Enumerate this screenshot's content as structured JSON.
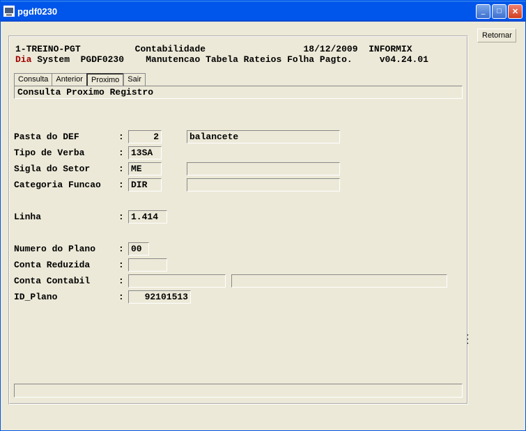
{
  "window": {
    "title": "pgdf0230"
  },
  "sidebar": {
    "retornar": "Retornar"
  },
  "header": {
    "line1_left": "1-TREINO-PGT",
    "line1_center": "Contabilidade",
    "line1_date": "18/12/2009",
    "line1_db": "INFORMIX",
    "line2_dia": "Dia",
    "line2_system": " System  PGDF0230",
    "line2_desc": "Manutencao Tabela Rateios Folha Pagto.",
    "line2_ver": "v04.24.01"
  },
  "tabs": {
    "consulta": "Consulta",
    "anterior": "Anterior",
    "proximo": "Proximo",
    "sair": "Sair"
  },
  "subbar": "Consulta Proximo Registro",
  "fields": {
    "pasta_def_label": "Pasta do DEF",
    "pasta_def_value": "2",
    "pasta_def_desc": "balancete",
    "tipo_verba_label": "Tipo de Verba",
    "tipo_verba_value": "13SA",
    "sigla_setor_label": "Sigla do Setor",
    "sigla_setor_value": "ME",
    "sigla_setor_desc": "",
    "cat_funcao_label": "Categoria Funcao",
    "cat_funcao_value": "DIR",
    "cat_funcao_desc": "",
    "linha_label": "Linha",
    "linha_value": "1.414",
    "num_plano_label": "Numero do Plano",
    "num_plano_value": "00",
    "conta_reduz_label": "Conta Reduzida",
    "conta_reduz_value": "",
    "conta_contab_label": "Conta Contabil",
    "conta_contab_value1": "",
    "conta_contab_value2": "",
    "id_plano_label": "ID_Plano",
    "id_plano_value": "92101513"
  }
}
